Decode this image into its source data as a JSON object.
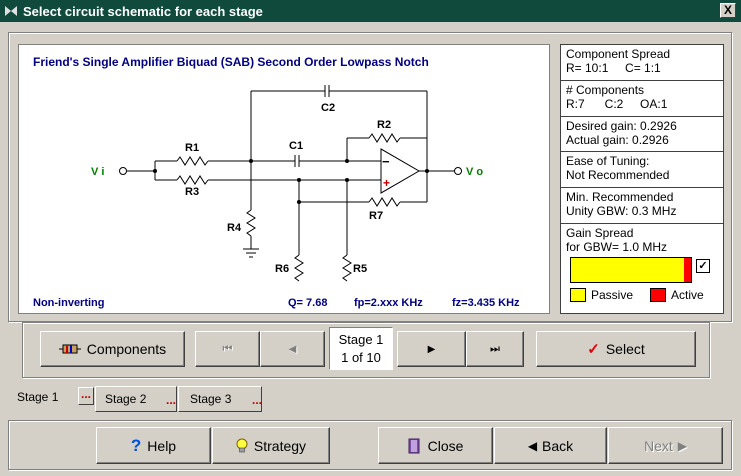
{
  "window": {
    "title": "Select circuit schematic for each stage",
    "close_label": "X"
  },
  "schematic": {
    "title": "Friend's Single Amplifier Biquad (SAB) Second Order Lowpass Notch",
    "labels": {
      "vi": "V i",
      "vo": "V o",
      "r1": "R1",
      "r2": "R2",
      "r3": "R3",
      "r4": "R4",
      "r5": "R5",
      "r6": "R6",
      "r7": "R7",
      "c1": "C1",
      "c2": "C2",
      "minus": "−",
      "plus": "+"
    },
    "mode": "Non-inverting",
    "q": "Q= 7.68",
    "fp": "fp=2.xxx KHz",
    "fz": "fz=3.435 KHz"
  },
  "info": {
    "spread_title": "Component Spread",
    "spread_value": "R= 10:1     C= 1:1",
    "components_title": "# Components",
    "components_value": "R:7      C:2     OA:1",
    "desired_gain": "Desired gain: 0.2926",
    "actual_gain": "Actual gain: 0.2926",
    "tuning_title": "Ease of Tuning:",
    "tuning_value": "Not Recommended",
    "gbw_title": "Min. Recommended",
    "gbw_value": "Unity GBW:  0.3 MHz",
    "gain_spread_title": "Gain Spread",
    "gain_spread_sub": "for GBW= 1.0 MHz",
    "gain_bar_passive_fraction": 0.94,
    "checkbox_mark": "✓",
    "legend_passive": "Passive",
    "legend_active": "Active",
    "passive_color": "#ffff00",
    "active_color": "#ff0000"
  },
  "nav": {
    "components_label": "Components",
    "first_icon": "⏮",
    "prev_icon": "◀",
    "stage_line1": "Stage 1",
    "stage_line2": "1 of 10",
    "next_icon": "▶",
    "last_icon": "⏭",
    "select_label": "Select"
  },
  "tabs": [
    {
      "label": "Stage 1",
      "dots": "..."
    },
    {
      "label": "Stage 2",
      "dots": "..."
    },
    {
      "label": "Stage 3",
      "dots": "..."
    }
  ],
  "footer": {
    "help_label": "Help",
    "strategy_label": "Strategy",
    "close_label": "Close",
    "back_label": "Back",
    "next_label": "Next"
  }
}
